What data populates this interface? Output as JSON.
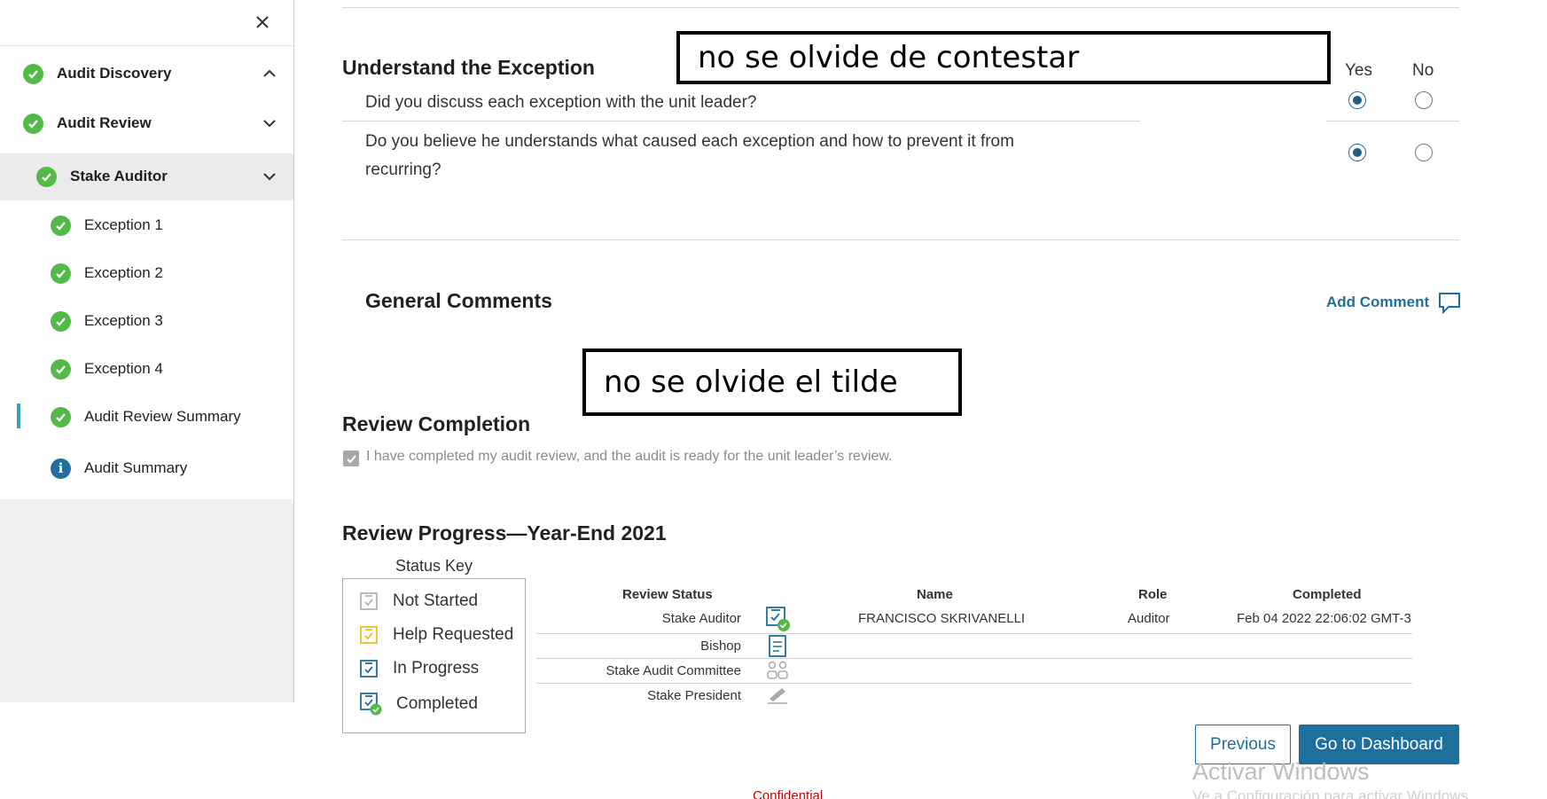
{
  "sidebar": {
    "items": [
      {
        "label": "Audit Discovery",
        "status": "completed",
        "chevron": "chevron-up-icon"
      },
      {
        "label": "Audit Review",
        "status": "completed",
        "chevron": "chevron-down-icon"
      },
      {
        "label": "Stake Auditor",
        "status": "completed",
        "chevron": "chevron-down-icon"
      },
      {
        "label": "Exception 1",
        "status": "completed"
      },
      {
        "label": "Exception 2",
        "status": "completed"
      },
      {
        "label": "Exception 3",
        "status": "completed"
      },
      {
        "label": "Exception 4",
        "status": "completed"
      },
      {
        "label": "Audit Review Summary",
        "status": "completed",
        "active": true
      },
      {
        "label": "Audit Summary",
        "status": "info"
      }
    ]
  },
  "exception_section": {
    "title": "Understand the Exception",
    "yes_label": "Yes",
    "no_label": "No",
    "questions": [
      {
        "text": "Did you discuss each exception with the unit leader?",
        "answer": "Yes"
      },
      {
        "text_line1": "Do you believe he understands what caused each exception and how to prevent it from",
        "text_line2": "recurring?",
        "answer": "Yes"
      }
    ]
  },
  "annotations": {
    "note1": "no se olvide de contestar",
    "note2": "no se olvide el tilde"
  },
  "general_comments": {
    "title": "General Comments",
    "add_comment_label": "Add Comment"
  },
  "review_completion": {
    "title": "Review Completion",
    "checkbox_label": "I have completed my audit review, and the audit is ready for the unit leader’s review.",
    "checked": true
  },
  "review_progress": {
    "title": "Review Progress—Year-End 2021",
    "status_key_title": "Status Key",
    "status_key": [
      {
        "label": "Not Started",
        "color": "#a8a8a8"
      },
      {
        "label": "Help Requested",
        "color": "#f4b400"
      },
      {
        "label": "In Progress",
        "color": "#1f6f9e"
      },
      {
        "label": "Completed",
        "color": "#1f6f9e"
      }
    ],
    "columns": {
      "review_status": "Review Status",
      "name": "Name",
      "role": "Role",
      "completed": "Completed"
    },
    "rows": [
      {
        "review_status": "Stake Auditor",
        "icon": "completed-icon",
        "name": "FRANCISCO SKRIVANELLI",
        "role": "Auditor",
        "completed": "Feb 04 2022 22:06:02 GMT-3"
      },
      {
        "review_status": "Bishop",
        "icon": "document-icon",
        "name": "",
        "role": "",
        "completed": ""
      },
      {
        "review_status": "Stake Audit Committee",
        "icon": "group-icon",
        "name": "",
        "role": "",
        "completed": ""
      },
      {
        "review_status": "Stake President",
        "icon": "signature-icon",
        "name": "",
        "role": "",
        "completed": ""
      }
    ]
  },
  "buttons": {
    "previous": "Previous",
    "dashboard": "Go to Dashboard"
  },
  "footer": {
    "watermark": "Activar Windows",
    "watermark_sub": "Ve a Configuración para activar Windows.",
    "confidential": "Confidential"
  }
}
